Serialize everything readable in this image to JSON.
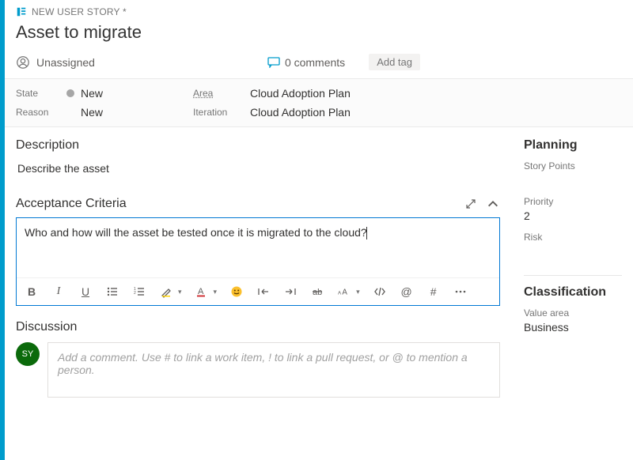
{
  "header": {
    "type_label": "NEW USER STORY *",
    "title": "Asset to migrate",
    "assignee": "Unassigned",
    "comments_count": "0 comments",
    "add_tag_label": "Add tag"
  },
  "fields": {
    "state_label": "State",
    "state_value": "New",
    "reason_label": "Reason",
    "reason_value": "New",
    "area_label": "Area",
    "area_value": "Cloud Adoption Plan",
    "iteration_label": "Iteration",
    "iteration_value": "Cloud Adoption Plan"
  },
  "sections": {
    "description_title": "Description",
    "description_text": "Describe the asset",
    "ac_title": "Acceptance Criteria",
    "ac_text": "Who and how will the asset be tested once it is migrated to the cloud?",
    "discussion_title": "Discussion",
    "discussion_placeholder": "Add a comment. Use # to link a work item, ! to link a pull request, or @ to mention a person."
  },
  "avatar": {
    "initials": "SY"
  },
  "planning": {
    "title": "Planning",
    "story_points_label": "Story Points",
    "priority_label": "Priority",
    "priority_value": "2",
    "risk_label": "Risk"
  },
  "classification": {
    "title": "Classification",
    "value_area_label": "Value area",
    "value_area_value": "Business"
  }
}
